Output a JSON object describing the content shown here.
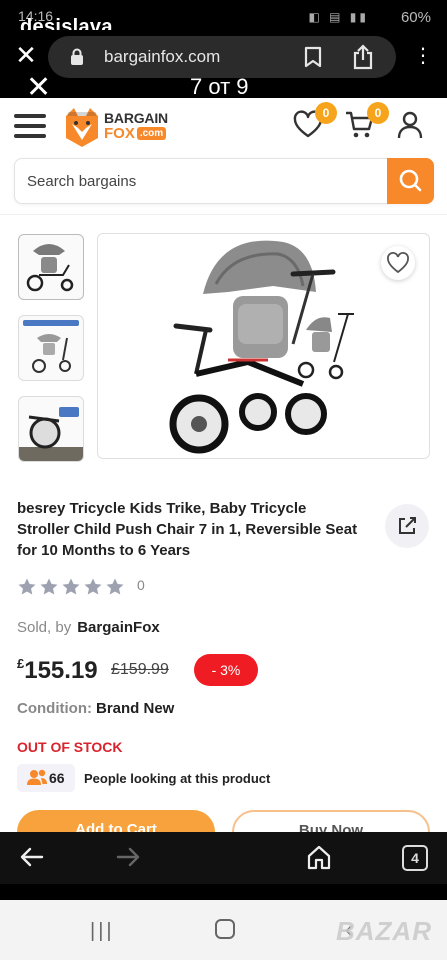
{
  "status_bar": {
    "time": "14:16",
    "overlay_user": "desislava",
    "battery": "60%"
  },
  "browser": {
    "url": "bargainfox.com",
    "tabs_count": "4"
  },
  "gallery": {
    "counter": "7 от 9"
  },
  "header": {
    "logo_line1": "BARGAIN",
    "logo_line2": "FOX",
    "logo_suffix": ".com",
    "wishlist_count": "0",
    "cart_count": "0"
  },
  "search": {
    "placeholder": "Search bargains"
  },
  "product": {
    "title": "besrey Tricycle Kids Trike, Baby Tricycle Stroller Child Push Chair 7 in 1, Reversible Seat for 10 Months to 6 Years",
    "rating_count": "0",
    "stars": 0,
    "sold_by_label": "Sold, by",
    "seller": "BargainFox",
    "price_currency": "£",
    "price": "155.19",
    "old_price": "£159.99",
    "discount": "- 3%",
    "condition_label": "Condition:",
    "condition": "Brand New",
    "stock_status": "OUT OF STOCK",
    "people_count": "66",
    "people_text": "People looking at this product",
    "add_to_cart": "Add to Cart",
    "buy_now": "Buy Now"
  },
  "watermark": "BAZAR",
  "colors": {
    "accent": "#f7892b",
    "badge": "#f7a41d",
    "discount": "#ef1c24",
    "stock": "#d9232d"
  }
}
